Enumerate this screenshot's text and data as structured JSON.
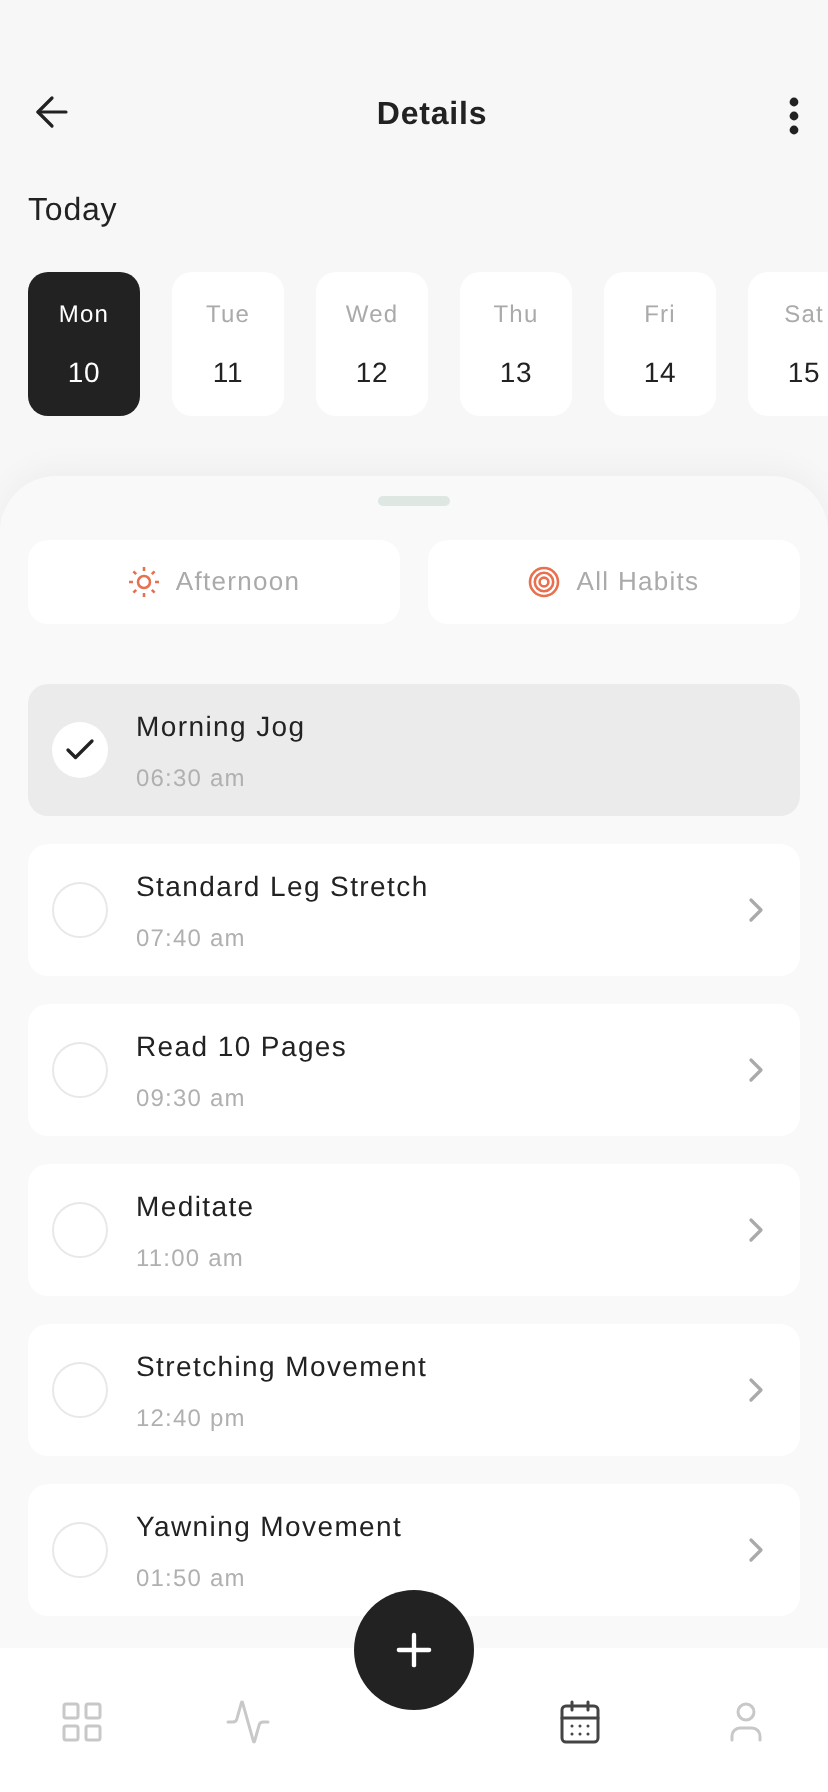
{
  "header": {
    "title": "Details"
  },
  "section_title": "Today",
  "days": [
    {
      "weekday": "Mon",
      "date": "10",
      "selected": true
    },
    {
      "weekday": "Tue",
      "date": "11",
      "selected": false
    },
    {
      "weekday": "Wed",
      "date": "12",
      "selected": false
    },
    {
      "weekday": "Thu",
      "date": "13",
      "selected": false
    },
    {
      "weekday": "Fri",
      "date": "14",
      "selected": false
    },
    {
      "weekday": "Sat",
      "date": "15",
      "selected": false
    }
  ],
  "filters": [
    {
      "kind": "sun",
      "label": "Afternoon"
    },
    {
      "kind": "target",
      "label": "All Habits"
    }
  ],
  "habits": [
    {
      "name": "Morning Jog",
      "time": "06:30 am",
      "checked": true
    },
    {
      "name": "Standard Leg Stretch",
      "time": "07:40 am",
      "checked": false
    },
    {
      "name": "Read 10 Pages",
      "time": "09:30 am",
      "checked": false
    },
    {
      "name": "Meditate",
      "time": "11:00 am",
      "checked": false
    },
    {
      "name": "Stretching Movement",
      "time": "12:40 pm",
      "checked": false
    },
    {
      "name": "Yawning Movement",
      "time": "01:50 am",
      "checked": false
    }
  ],
  "nav": [
    {
      "kind": "grid",
      "selected": false
    },
    {
      "kind": "pulse",
      "selected": false
    },
    {
      "kind": "calendar",
      "selected": true
    },
    {
      "kind": "profile",
      "selected": false
    }
  ]
}
